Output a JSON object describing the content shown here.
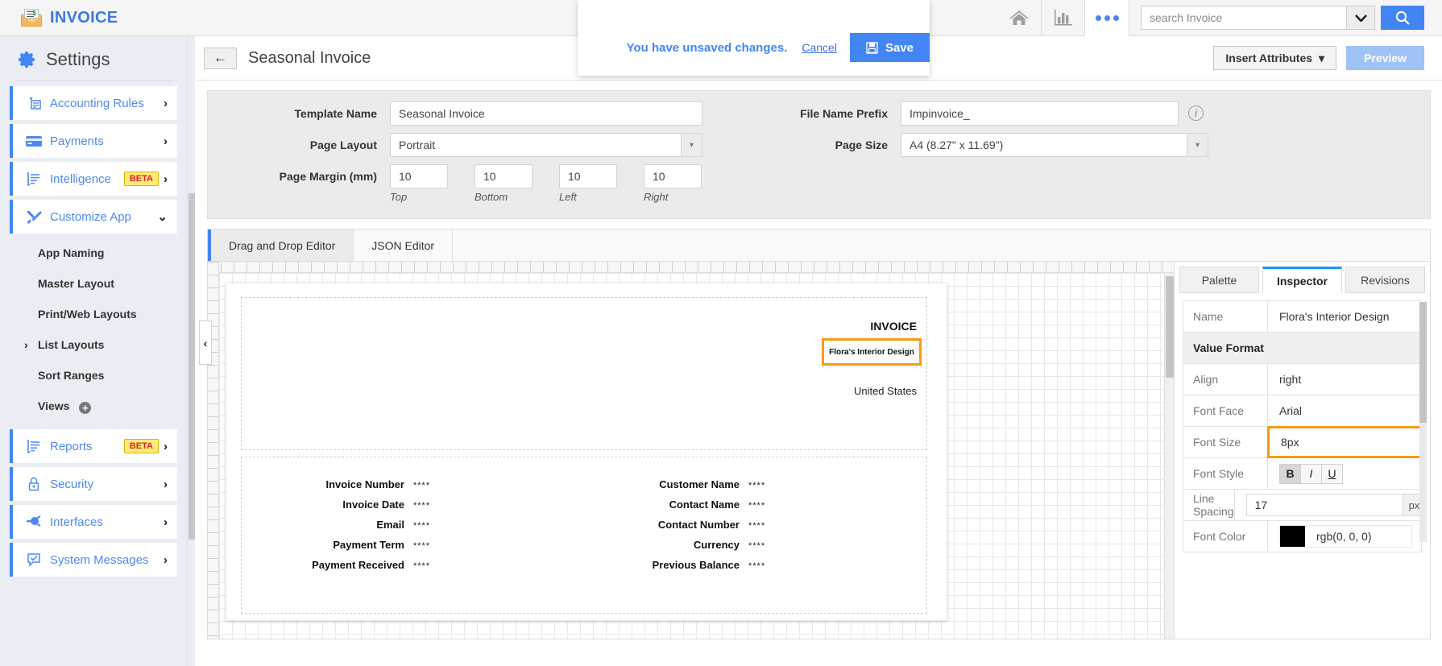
{
  "app": {
    "brand": "INVOICE",
    "logo_icon": "invoice-envelope-icon"
  },
  "topbar": {
    "home_icon": "home-icon",
    "charts_icon": "bar-chart-icon",
    "more_icon": "more-dots-icon",
    "search_placeholder": "search Invoice",
    "search_value": "",
    "search_dropdown_icon": "chevron-down-icon",
    "search_button_icon": "search-icon"
  },
  "sidebar": {
    "title": "Settings",
    "title_icon": "gear-icon",
    "items": [
      {
        "label": "Accounting Rules",
        "icon": "accounting-rules-icon",
        "chevron": "›",
        "badge": null
      },
      {
        "label": "Payments",
        "icon": "credit-card-icon",
        "chevron": "›",
        "badge": null
      },
      {
        "label": "Intelligence",
        "icon": "intelligence-icon",
        "chevron": "›",
        "badge": "BETA"
      },
      {
        "label": "Customize App",
        "icon": "tools-icon",
        "chevron": "⌄",
        "badge": null
      }
    ],
    "sub_items": [
      {
        "label": "App Naming",
        "caret": false
      },
      {
        "label": "Master Layout",
        "caret": false
      },
      {
        "label": "Print/Web Layouts",
        "caret": false
      },
      {
        "label": "List Layouts",
        "caret": true
      },
      {
        "label": "Sort Ranges",
        "caret": false
      },
      {
        "label": "Views",
        "caret": false,
        "plus": "+"
      }
    ],
    "items2": [
      {
        "label": "Reports",
        "icon": "reports-icon",
        "chevron": "›",
        "badge": "BETA"
      },
      {
        "label": "Security",
        "icon": "lock-icon",
        "chevron": "›",
        "badge": null
      },
      {
        "label": "Interfaces",
        "icon": "plug-icon",
        "chevron": "›",
        "badge": null
      },
      {
        "label": "System Messages",
        "icon": "message-check-icon",
        "chevron": "›",
        "badge": null
      }
    ]
  },
  "page": {
    "back_icon": "back-arrow-icon",
    "title": "Seasonal Invoice",
    "insert_attributes_label": "Insert Attributes",
    "insert_attributes_icon": "caret-down-icon",
    "preview_label": "Preview"
  },
  "unsaved_banner": {
    "message": "You have unsaved changes.",
    "cancel_label": "Cancel",
    "save_label": "Save",
    "save_icon": "floppy-disk-icon"
  },
  "form": {
    "template_name_label": "Template Name",
    "template_name_value": "Seasonal Invoice",
    "page_layout_label": "Page Layout",
    "page_layout_value": "Portrait",
    "page_margin_label": "Page Margin (mm)",
    "margins": [
      {
        "value": "10",
        "caption": "Top"
      },
      {
        "value": "10",
        "caption": "Bottom"
      },
      {
        "value": "10",
        "caption": "Left"
      },
      {
        "value": "10",
        "caption": "Right"
      }
    ],
    "file_name_prefix_label": "File Name Prefix",
    "file_name_prefix_value": "Impinvoice_",
    "file_name_info_icon": "info-icon",
    "page_size_label": "Page Size",
    "page_size_value": "A4 (8.27\" x 11.69\")"
  },
  "editor_tabs": [
    {
      "label": "Drag and Drop Editor",
      "active": true
    },
    {
      "label": "JSON Editor",
      "active": false
    }
  ],
  "canvas": {
    "collapse_icon": "chevron-left-icon",
    "invoice_title": "INVOICE",
    "selected_element_text": "Flora's Interior Design",
    "country": "United States",
    "left_fields": [
      {
        "label": "Invoice Number",
        "value": "****"
      },
      {
        "label": "Invoice Date",
        "value": "****"
      },
      {
        "label": "Email",
        "value": "****"
      },
      {
        "label": "Payment Term",
        "value": "****"
      },
      {
        "label": "Payment Received",
        "value": "****"
      }
    ],
    "right_fields": [
      {
        "label": "Customer Name",
        "value": "****"
      },
      {
        "label": "Contact Name",
        "value": "****"
      },
      {
        "label": "Contact Number",
        "value": "****"
      },
      {
        "label": "Currency",
        "value": "****"
      },
      {
        "label": "Previous Balance",
        "value": "****"
      }
    ]
  },
  "inspector": {
    "tabs": [
      {
        "label": "Palette",
        "active": false
      },
      {
        "label": "Inspector",
        "active": true
      },
      {
        "label": "Revisions",
        "active": false
      }
    ],
    "name_label": "Name",
    "name_value": "Flora's Interior Design",
    "section_label": "Value Format",
    "align_label": "Align",
    "align_value": "right",
    "font_face_label": "Font Face",
    "font_face_value": "Arial",
    "font_size_label": "Font Size",
    "font_size_value": "8px",
    "font_style_label": "Font Style",
    "font_style_bold": "B",
    "font_style_italic": "I",
    "font_style_underline": "U",
    "line_spacing_label": "Line Spacing",
    "line_spacing_value": "17",
    "line_spacing_unit": "px",
    "font_color_label": "Font Color",
    "font_color_value": "rgb(0, 0, 0)",
    "font_color_hex": "#000000"
  },
  "colors": {
    "accent_blue": "#4285f4",
    "highlight_orange": "#f59b12",
    "beta_yellow": "#ffeb7a",
    "beta_red": "#e02020"
  }
}
